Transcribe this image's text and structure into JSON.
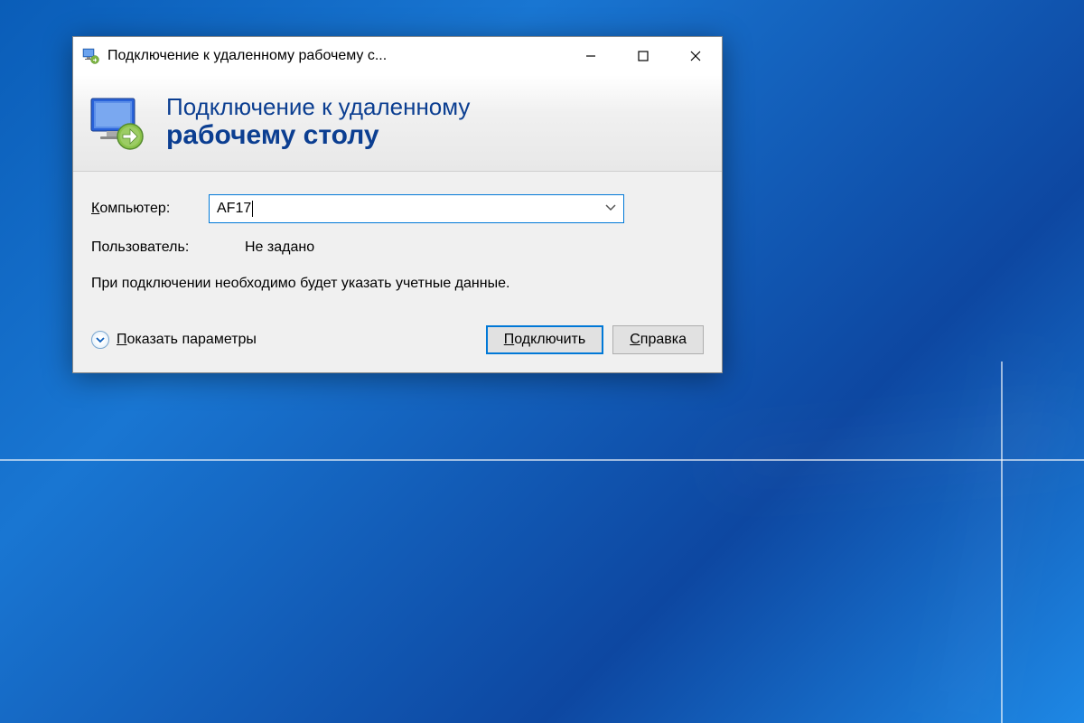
{
  "window": {
    "title": "Подключение к удаленному рабочему с..."
  },
  "header": {
    "line1": "Подключение к удаленному",
    "line2": "рабочему столу"
  },
  "form": {
    "computer_label_prefix": "К",
    "computer_label_rest": "омпьютер:",
    "computer_value": "AF17",
    "user_label": "Пользователь:",
    "user_value": "Не задано",
    "info_text": "При подключении необходимо будет указать учетные данные."
  },
  "footer": {
    "show_options_prefix": "П",
    "show_options_rest": "оказать параметры",
    "connect_prefix": "П",
    "connect_rest": "одключить",
    "help_prefix": "С",
    "help_rest": "правка"
  }
}
